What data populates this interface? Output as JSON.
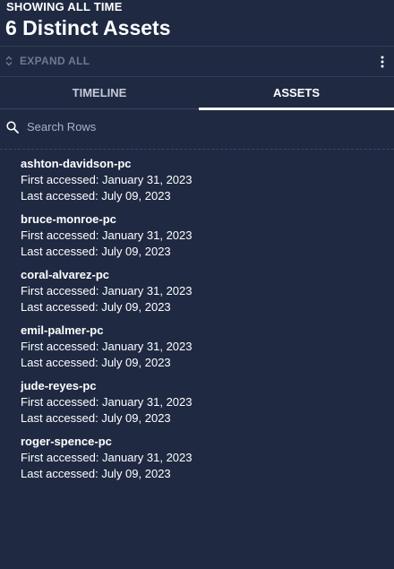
{
  "header": {
    "range_label": "SHOWING ALL TIME",
    "title": "6 Distinct Assets"
  },
  "toolbar": {
    "expand_all_label": "EXPAND ALL",
    "expand_icon": "unfold-icon",
    "menu_icon": "more-vertical-icon"
  },
  "tabs": [
    {
      "label": "TIMELINE",
      "active": false
    },
    {
      "label": "ASSETS",
      "active": true
    }
  ],
  "search": {
    "placeholder": "Search Rows",
    "value": "",
    "icon": "search-icon"
  },
  "assets": [
    {
      "name": "ashton-davidson-pc",
      "first": "First accessed: January 31, 2023",
      "last": "Last accessed: July 09, 2023"
    },
    {
      "name": "bruce-monroe-pc",
      "first": "First accessed: January 31, 2023",
      "last": "Last accessed: July 09, 2023"
    },
    {
      "name": "coral-alvarez-pc",
      "first": "First accessed: January 31, 2023",
      "last": "Last accessed: July 09, 2023"
    },
    {
      "name": "emil-palmer-pc",
      "first": "First accessed: January 31, 2023",
      "last": "Last accessed: July 09, 2023"
    },
    {
      "name": "jude-reyes-pc",
      "first": "First accessed: January 31, 2023",
      "last": "Last accessed: July 09, 2023"
    },
    {
      "name": "roger-spence-pc",
      "first": "First accessed: January 31, 2023",
      "last": "Last accessed: July 09, 2023"
    }
  ],
  "colors": {
    "background": "#1f2942",
    "divider": "#323d57",
    "muted_text": "#6f7a92",
    "active_tab_indicator": "#ffffff"
  }
}
